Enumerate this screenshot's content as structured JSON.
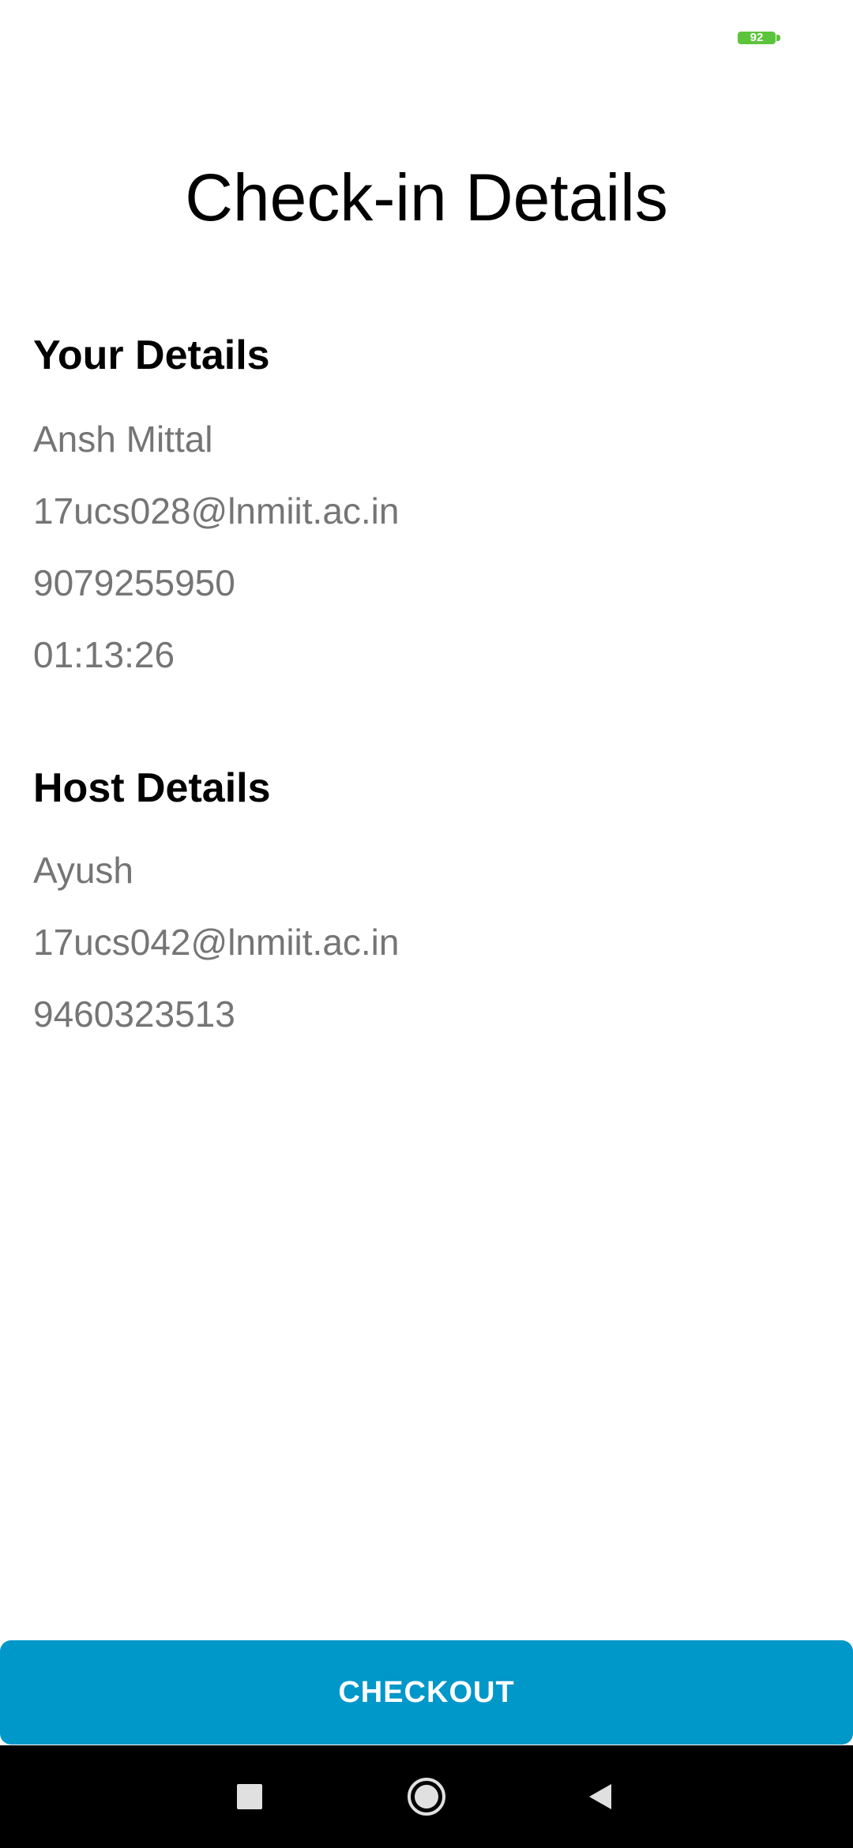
{
  "status_bar": {
    "battery_level": "92",
    "battery_color": "#5cc43a"
  },
  "page": {
    "title": "Check-in Details"
  },
  "your_details": {
    "heading": "Your Details",
    "name": "Ansh Mittal",
    "email": "17ucs028@lnmiit.ac.in",
    "phone": "9079255950",
    "time": "01:13:26"
  },
  "host_details": {
    "heading": "Host Details",
    "name": "Ayush",
    "email": "17ucs042@lnmiit.ac.in",
    "phone": "9460323513"
  },
  "checkout": {
    "label": "CHECKOUT",
    "color": "#0097c9"
  },
  "nav_bar": {
    "recents_icon": "square-icon",
    "home_icon": "circle-icon",
    "back_icon": "triangle-back-icon"
  }
}
